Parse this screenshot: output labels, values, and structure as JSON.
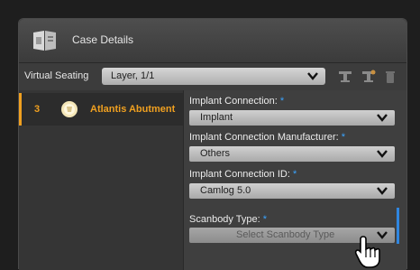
{
  "header": {
    "title": "Case Details",
    "icon": "case-details-icon"
  },
  "virtual_seating": {
    "label": "Virtual Seating",
    "selected": "Layer, 1/1",
    "tools": [
      "layer-tool-icon",
      "layer-edit-icon",
      "trash-icon"
    ]
  },
  "list": {
    "items": [
      {
        "number": "3",
        "name": "Atlantis Abutment",
        "icon": "abutment-icon"
      }
    ]
  },
  "form": {
    "fields": [
      {
        "label": "Implant Connection:",
        "value": "Implant"
      },
      {
        "label": "Implant Connection Manufacturer:",
        "value": "Others"
      },
      {
        "label": "Implant Connection ID:",
        "value": "Camlog 5.0"
      },
      {
        "label": "Scanbody Type:",
        "placeholder": "Select Scanbody Type"
      }
    ]
  },
  "colors": {
    "accent": "#f0a020",
    "required": "#3aa4ff",
    "active": "#2f86e0"
  }
}
